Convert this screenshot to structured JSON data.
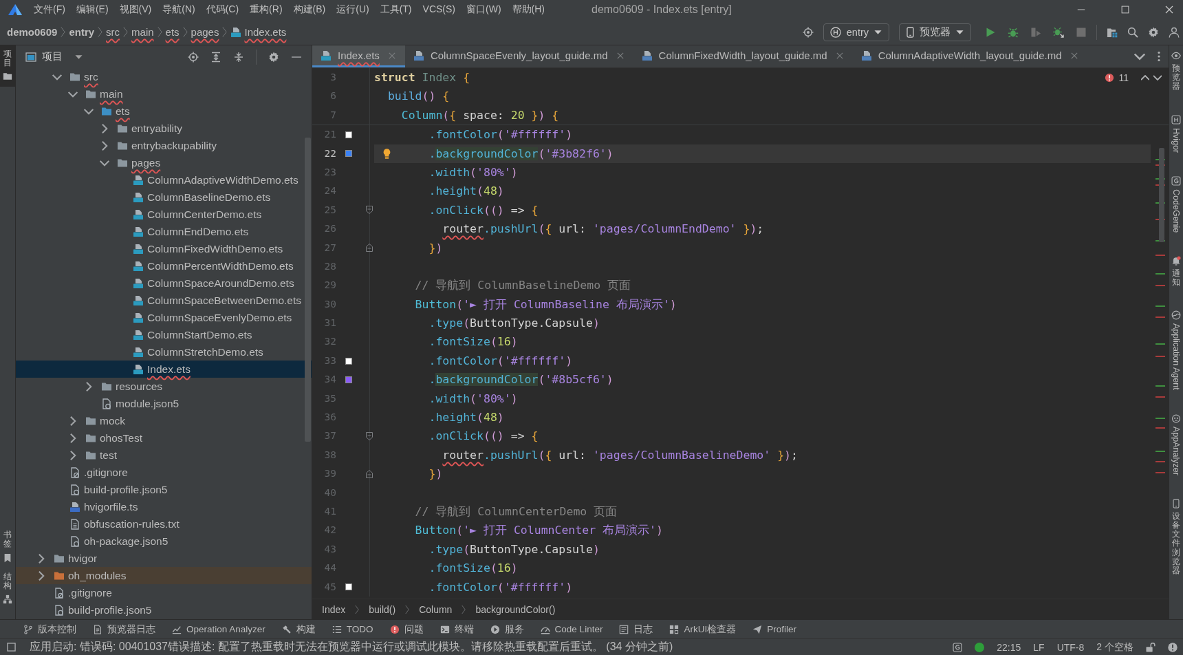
{
  "title_bar": {
    "menu": [
      "文件(F)",
      "编辑(E)",
      "视图(V)",
      "导航(N)",
      "代码(C)",
      "重构(R)",
      "构建(B)",
      "运行(U)",
      "工具(T)",
      "VCS(S)",
      "窗口(W)",
      "帮助(H)"
    ],
    "title": "demo0609 - Index.ets [entry]"
  },
  "nav_bar": {
    "breadcrumb": [
      {
        "label": "demo0609",
        "kind": "module",
        "error": false
      },
      {
        "label": "entry",
        "kind": "module",
        "error": false
      },
      {
        "label": "src",
        "kind": "folder",
        "error": true
      },
      {
        "label": "main",
        "kind": "folder",
        "error": true
      },
      {
        "label": "ets",
        "kind": "folder",
        "error": true
      },
      {
        "label": "pages",
        "kind": "folder",
        "error": true
      },
      {
        "label": "Index.ets",
        "kind": "file",
        "error": true
      }
    ],
    "module": "entry",
    "device": "预览器",
    "run_actions": [
      {
        "disabled": false
      },
      {
        "disabled": false
      },
      {
        "disabled": true
      },
      {
        "disabled": false
      },
      {
        "disabled": true
      }
    ]
  },
  "left_strip": [
    {
      "label": "项目",
      "selected": true
    },
    {
      "label": "书签",
      "selected": false
    },
    {
      "label": "结构",
      "selected": false
    }
  ],
  "project_panel": {
    "title": "项目",
    "tree": [
      {
        "children": [
          {
            "label": "src",
            "kind": "folder",
            "expanded": true,
            "selected": false,
            "error": true,
            "children": [
              {
                "label": "main",
                "kind": "folder",
                "expanded": true,
                "selected": false,
                "error": true,
                "children": [
                  {
                    "label": "ets",
                    "kind": "source-folder",
                    "expanded": true,
                    "selected": false,
                    "error": true,
                    "children": [
                      {
                        "label": "entryability",
                        "kind": "folder",
                        "expanded": false,
                        "selected": false,
                        "error": false
                      },
                      {
                        "label": "entrybackupability",
                        "kind": "folder",
                        "expanded": false,
                        "selected": false,
                        "error": false
                      },
                      {
                        "label": "pages",
                        "kind": "folder",
                        "expanded": true,
                        "selected": false,
                        "error": true,
                        "children": [
                          {
                            "label": "ColumnAdaptiveWidthDemo.ets",
                            "kind": "ets-file",
                            "selected": false,
                            "error": false
                          },
                          {
                            "label": "ColumnBaselineDemo.ets",
                            "kind": "ets-file",
                            "selected": false,
                            "error": false
                          },
                          {
                            "label": "ColumnCenterDemo.ets",
                            "kind": "ets-file",
                            "selected": false,
                            "error": false
                          },
                          {
                            "label": "ColumnEndDemo.ets",
                            "kind": "ets-file",
                            "selected": false,
                            "error": false
                          },
                          {
                            "label": "ColumnFixedWidthDemo.ets",
                            "kind": "ets-file",
                            "selected": false,
                            "error": false
                          },
                          {
                            "label": "ColumnPercentWidthDemo.ets",
                            "kind": "ets-file",
                            "selected": false,
                            "error": false
                          },
                          {
                            "label": "ColumnSpaceAroundDemo.ets",
                            "kind": "ets-file",
                            "selected": false,
                            "error": false
                          },
                          {
                            "label": "ColumnSpaceBetweenDemo.ets",
                            "kind": "ets-file",
                            "selected": false,
                            "error": false
                          },
                          {
                            "label": "ColumnSpaceEvenlyDemo.ets",
                            "kind": "ets-file",
                            "selected": false,
                            "error": false
                          },
                          {
                            "label": "ColumnStartDemo.ets",
                            "kind": "ets-file",
                            "selected": false,
                            "error": false
                          },
                          {
                            "label": "ColumnStretchDemo.ets",
                            "kind": "ets-file",
                            "selected": false,
                            "error": false
                          },
                          {
                            "label": "Index.ets",
                            "kind": "ets-file",
                            "selected": true,
                            "error": true
                          }
                        ]
                      }
                    ]
                  },
                  {
                    "label": "resources",
                    "kind": "folder",
                    "expanded": false,
                    "selected": false,
                    "error": false
                  },
                  {
                    "label": "module.json5",
                    "kind": "json-file",
                    "selected": false,
                    "error": false
                  }
                ]
              },
              {
                "label": "mock",
                "kind": "folder",
                "expanded": false,
                "selected": false,
                "error": false
              },
              {
                "label": "ohosTest",
                "kind": "folder",
                "expanded": false,
                "selected": false,
                "error": false
              },
              {
                "label": "test",
                "kind": "folder",
                "expanded": false,
                "selected": false,
                "error": false
              }
            ]
          },
          {
            "label": ".gitignore",
            "kind": "ignore-file",
            "selected": false,
            "error": false
          },
          {
            "label": "build-profile.json5",
            "kind": "json-file",
            "selected": false,
            "error": false
          },
          {
            "label": "hvigorfile.ts",
            "kind": "ts-file",
            "selected": false,
            "error": false
          },
          {
            "label": "obfuscation-rules.txt",
            "kind": "text-file",
            "selected": false,
            "error": false
          },
          {
            "label": "oh-package.json5",
            "kind": "json-file",
            "selected": false,
            "error": false
          }
        ]
      },
      {
        "label": "hvigor",
        "kind": "folder",
        "expanded": false,
        "selected": false,
        "error": false
      },
      {
        "label": "oh_modules",
        "kind": "library-folder",
        "expanded": false,
        "selected": false,
        "error": false
      },
      {
        "label": ".gitignore",
        "kind": "ignore-file",
        "selected": false,
        "error": false
      },
      {
        "label": "build-profile.json5",
        "kind": "json-file",
        "selected": false,
        "error": false
      }
    ]
  },
  "editor": {
    "tabs": [
      {
        "label": "Index.ets",
        "kind": "ets",
        "selected": true,
        "error": true
      },
      {
        "label": "ColumnSpaceEvenly_layout_guide.md",
        "kind": "md",
        "selected": false,
        "error": false
      },
      {
        "label": "ColumnFixedWidth_layout_guide.md",
        "kind": "md",
        "selected": false,
        "error": false
      },
      {
        "label": "ColumnAdaptiveWidth_layout_guide.md",
        "kind": "md",
        "selected": false,
        "error": false
      }
    ],
    "problems": "11",
    "sticky_lines": [
      {
        "number": "3",
        "tokens": [
          {
            "kind": "keyword",
            "text": "struct "
          },
          {
            "kind": "type-name",
            "text": "Index "
          },
          {
            "kind": "brace",
            "text": "{"
          }
        ]
      },
      {
        "number": "6",
        "tokens": [
          {
            "kind": "function",
            "text": "  build"
          },
          {
            "kind": "paren",
            "text": "()"
          },
          {
            "kind": "brace",
            "text": " {"
          }
        ]
      },
      {
        "number": "7",
        "tokens": [
          {
            "kind": "component",
            "text": "    Column"
          },
          {
            "kind": "paren",
            "text": "("
          },
          {
            "kind": "brace",
            "text": "{"
          },
          {
            "kind": "plain",
            "text": " space: "
          },
          {
            "kind": "number",
            "text": "20"
          },
          {
            "kind": "brace",
            "text": " }"
          },
          {
            "kind": "paren",
            "text": ")"
          },
          {
            "kind": "brace",
            "text": " {"
          }
        ]
      }
    ],
    "lines": [
      {
        "number": "21",
        "current": false,
        "color": "#ffffff",
        "tokens": [
          {
            "kind": "method",
            "text": "        .fontColor"
          },
          {
            "kind": "paren",
            "text": "("
          },
          {
            "kind": "string",
            "text": "'#ffffff'"
          },
          {
            "kind": "paren",
            "text": ")"
          }
        ]
      },
      {
        "number": "22",
        "current": true,
        "color": "#3b82f6",
        "bulb": true,
        "tokens": [
          {
            "kind": "method",
            "text": "        ."
          },
          {
            "kind": "usage",
            "text": "backgroundColor"
          },
          {
            "kind": "paren",
            "text": "("
          },
          {
            "kind": "string",
            "text": "'#3b82f6'"
          },
          {
            "kind": "paren",
            "text": ")"
          }
        ]
      },
      {
        "number": "23",
        "current": false,
        "tokens": [
          {
            "kind": "method",
            "text": "        .width"
          },
          {
            "kind": "paren",
            "text": "("
          },
          {
            "kind": "string",
            "text": "'80%'"
          },
          {
            "kind": "paren",
            "text": ")"
          }
        ]
      },
      {
        "number": "24",
        "current": false,
        "tokens": [
          {
            "kind": "method",
            "text": "        .height"
          },
          {
            "kind": "paren",
            "text": "("
          },
          {
            "kind": "number",
            "text": "48"
          },
          {
            "kind": "paren",
            "text": ")"
          }
        ]
      },
      {
        "number": "25",
        "current": false,
        "fold_start": true,
        "tokens": [
          {
            "kind": "method",
            "text": "        .onClick"
          },
          {
            "kind": "paren",
            "text": "(()"
          },
          {
            "kind": "plain",
            "text": " =>"
          },
          {
            "kind": "brace",
            "text": " {"
          }
        ]
      },
      {
        "number": "26",
        "current": false,
        "tokens": [
          {
            "kind": "unresolved",
            "text": "          router"
          },
          {
            "kind": "method",
            "text": ".pushUrl"
          },
          {
            "kind": "paren",
            "text": "("
          },
          {
            "kind": "brace",
            "text": "{"
          },
          {
            "kind": "plain",
            "text": " url: "
          },
          {
            "kind": "string",
            "text": "'pages/ColumnEndDemo'"
          },
          {
            "kind": "brace",
            "text": " }"
          },
          {
            "kind": "paren",
            "text": ")"
          },
          {
            "kind": "plain",
            "text": ";"
          }
        ]
      },
      {
        "number": "27",
        "current": false,
        "fold_end": true,
        "tokens": [
          {
            "kind": "brace",
            "text": "        }"
          },
          {
            "kind": "paren",
            "text": ")"
          }
        ]
      },
      {
        "number": "28",
        "current": false
      },
      {
        "number": "29",
        "current": false,
        "tokens": [
          {
            "kind": "comment",
            "text": "      // 导航到 ColumnBaselineDemo 页面"
          }
        ]
      },
      {
        "number": "30",
        "current": false,
        "tokens": [
          {
            "kind": "component",
            "text": "      Button"
          },
          {
            "kind": "paren",
            "text": "("
          },
          {
            "kind": "string",
            "text": "'► 打开 ColumnBaseline 布局演示'"
          },
          {
            "kind": "paren",
            "text": ")"
          }
        ]
      },
      {
        "number": "31",
        "current": false,
        "tokens": [
          {
            "kind": "method",
            "text": "        .type"
          },
          {
            "kind": "paren",
            "text": "("
          },
          {
            "kind": "plain",
            "text": "ButtonType.Capsule"
          },
          {
            "kind": "paren",
            "text": ")"
          }
        ]
      },
      {
        "number": "32",
        "current": false,
        "tokens": [
          {
            "kind": "method",
            "text": "        .fontSize"
          },
          {
            "kind": "paren",
            "text": "("
          },
          {
            "kind": "number",
            "text": "16"
          },
          {
            "kind": "paren",
            "text": ")"
          }
        ]
      },
      {
        "number": "33",
        "current": false,
        "color": "#ffffff",
        "tokens": [
          {
            "kind": "method",
            "text": "        .fontColor"
          },
          {
            "kind": "paren",
            "text": "("
          },
          {
            "kind": "string",
            "text": "'#ffffff'"
          },
          {
            "kind": "paren",
            "text": ")"
          }
        ]
      },
      {
        "number": "34",
        "current": false,
        "color": "#8b5cf6",
        "tokens": [
          {
            "kind": "method",
            "text": "        ."
          },
          {
            "kind": "usage",
            "text": "backgroundColor"
          },
          {
            "kind": "paren",
            "text": "("
          },
          {
            "kind": "string",
            "text": "'#8b5cf6'"
          },
          {
            "kind": "paren",
            "text": ")"
          }
        ]
      },
      {
        "number": "35",
        "current": false,
        "tokens": [
          {
            "kind": "method",
            "text": "        .width"
          },
          {
            "kind": "paren",
            "text": "("
          },
          {
            "kind": "string",
            "text": "'80%'"
          },
          {
            "kind": "paren",
            "text": ")"
          }
        ]
      },
      {
        "number": "36",
        "current": false,
        "tokens": [
          {
            "kind": "method",
            "text": "        .height"
          },
          {
            "kind": "paren",
            "text": "("
          },
          {
            "kind": "number",
            "text": "48"
          },
          {
            "kind": "paren",
            "text": ")"
          }
        ]
      },
      {
        "number": "37",
        "current": false,
        "fold_start": true,
        "tokens": [
          {
            "kind": "method",
            "text": "        .onClick"
          },
          {
            "kind": "paren",
            "text": "(()"
          },
          {
            "kind": "plain",
            "text": " =>"
          },
          {
            "kind": "brace",
            "text": " {"
          }
        ]
      },
      {
        "number": "38",
        "current": false,
        "tokens": [
          {
            "kind": "unresolved",
            "text": "          router"
          },
          {
            "kind": "method",
            "text": ".pushUrl"
          },
          {
            "kind": "paren",
            "text": "("
          },
          {
            "kind": "brace",
            "text": "{"
          },
          {
            "kind": "plain",
            "text": " url: "
          },
          {
            "kind": "string",
            "text": "'pages/ColumnBaselineDemo'"
          },
          {
            "kind": "brace",
            "text": " }"
          },
          {
            "kind": "paren",
            "text": ")"
          },
          {
            "kind": "plain",
            "text": ";"
          }
        ]
      },
      {
        "number": "39",
        "current": false,
        "fold_end": true,
        "tokens": [
          {
            "kind": "brace",
            "text": "        }"
          },
          {
            "kind": "paren",
            "text": ")"
          }
        ]
      },
      {
        "number": "40",
        "current": false
      },
      {
        "number": "41",
        "current": false,
        "tokens": [
          {
            "kind": "comment",
            "text": "      // 导航到 ColumnCenterDemo 页面"
          }
        ]
      },
      {
        "number": "42",
        "current": false,
        "tokens": [
          {
            "kind": "component",
            "text": "      Button"
          },
          {
            "kind": "paren",
            "text": "("
          },
          {
            "kind": "string",
            "text": "'► 打开 ColumnCenter 布局演示'"
          },
          {
            "kind": "paren",
            "text": ")"
          }
        ]
      },
      {
        "number": "43",
        "current": false,
        "tokens": [
          {
            "kind": "method",
            "text": "        .type"
          },
          {
            "kind": "paren",
            "text": "("
          },
          {
            "kind": "plain",
            "text": "ButtonType.Capsule"
          },
          {
            "kind": "paren",
            "text": ")"
          }
        ]
      },
      {
        "number": "44",
        "current": false,
        "tokens": [
          {
            "kind": "method",
            "text": "        .fontSize"
          },
          {
            "kind": "paren",
            "text": "("
          },
          {
            "kind": "number",
            "text": "16"
          },
          {
            "kind": "paren",
            "text": ")"
          }
        ]
      },
      {
        "number": "45",
        "current": false,
        "color": "#ffffff",
        "tokens": [
          {
            "kind": "method",
            "text": "        .fontColor"
          },
          {
            "kind": "paren",
            "text": "("
          },
          {
            "kind": "string",
            "text": "'#ffffff'"
          },
          {
            "kind": "paren",
            "text": ")"
          }
        ]
      }
    ],
    "breadcrumb": [
      "Index",
      "build()",
      "Column",
      "backgroundColor()"
    ]
  },
  "right_strip": [
    {
      "label": "预览器",
      "unread": false
    },
    {
      "label": "Hvigor",
      "unread": false
    },
    {
      "label": "CodeGenie",
      "unread": false
    },
    {
      "label": "通知",
      "unread": true
    },
    {
      "label": "Application Agent",
      "unread": false
    },
    {
      "label": "AppAnalyzer",
      "unread": false
    },
    {
      "label": "设备文件浏览器",
      "unread": false
    }
  ],
  "bottom_toolbar": [
    "版本控制",
    "预览器日志",
    "Operation Analyzer",
    "构建",
    "TODO",
    "问题",
    "终端",
    "服务",
    "Code Linter",
    "日志",
    "ArkUI检查器",
    "Profiler"
  ],
  "status_bar": {
    "message": "应用启动: 错误码: 00401037错误描述: 配置了热重载时无法在预览器中运行或调试此模块。请移除热重载配置后重试。 (34 分钟之前)",
    "time": "22:15",
    "line_separator": "LF",
    "encoding": "UTF-8",
    "indent": "2 个空格"
  }
}
